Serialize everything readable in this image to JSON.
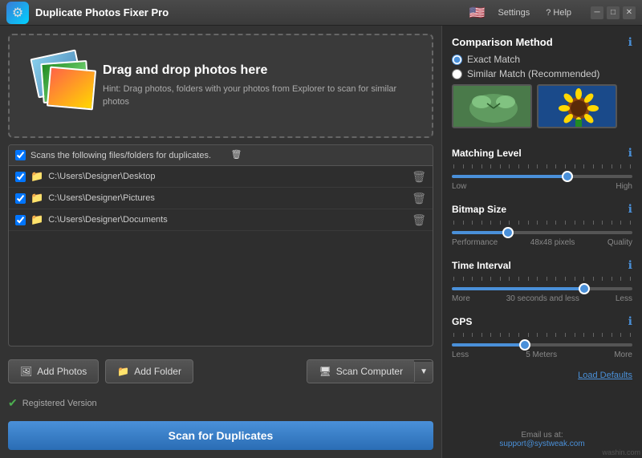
{
  "titleBar": {
    "title": "Duplicate Photos Fixer Pro",
    "settingsLabel": "Settings",
    "helpLabel": "? Help"
  },
  "dragDrop": {
    "heading": "Drag and drop photos here",
    "hint": "Hint: Drag photos, folders with your photos from Explorer to scan for similar photos"
  },
  "fileList": {
    "headerLabel": "Scans the following files/folders for duplicates.",
    "items": [
      {
        "path": "C:\\Users\\Designer\\Desktop"
      },
      {
        "path": "C:\\Users\\Designer\\Pictures"
      },
      {
        "path": "C:\\Users\\Designer\\Documents"
      }
    ]
  },
  "buttons": {
    "addPhotos": "Add Photos",
    "addFolder": "Add Folder",
    "scanComputer": "Scan Computer",
    "scanDuplicates": "Scan for Duplicates",
    "loadDefaults": "Load Defaults"
  },
  "status": {
    "label": "Registered Version"
  },
  "settings": {
    "sectionTitle": "Comparison Method",
    "exactMatch": "Exact Match",
    "similarMatch": "Similar Match (Recommended)",
    "matchingLevel": {
      "label": "Matching Level",
      "low": "Low",
      "high": "High",
      "value": 65
    },
    "bitmapSize": {
      "label": "Bitmap Size",
      "left": "Performance",
      "center": "48x48 pixels",
      "right": "Quality",
      "value": 30
    },
    "timeInterval": {
      "label": "Time Interval",
      "left": "More",
      "center": "30 seconds and less",
      "right": "Less",
      "value": 75
    },
    "gps": {
      "label": "GPS",
      "left": "Less",
      "center": "5 Meters",
      "right": "More",
      "value": 40
    }
  },
  "email": {
    "label": "Email us at:",
    "address": "support@systweak.com"
  }
}
